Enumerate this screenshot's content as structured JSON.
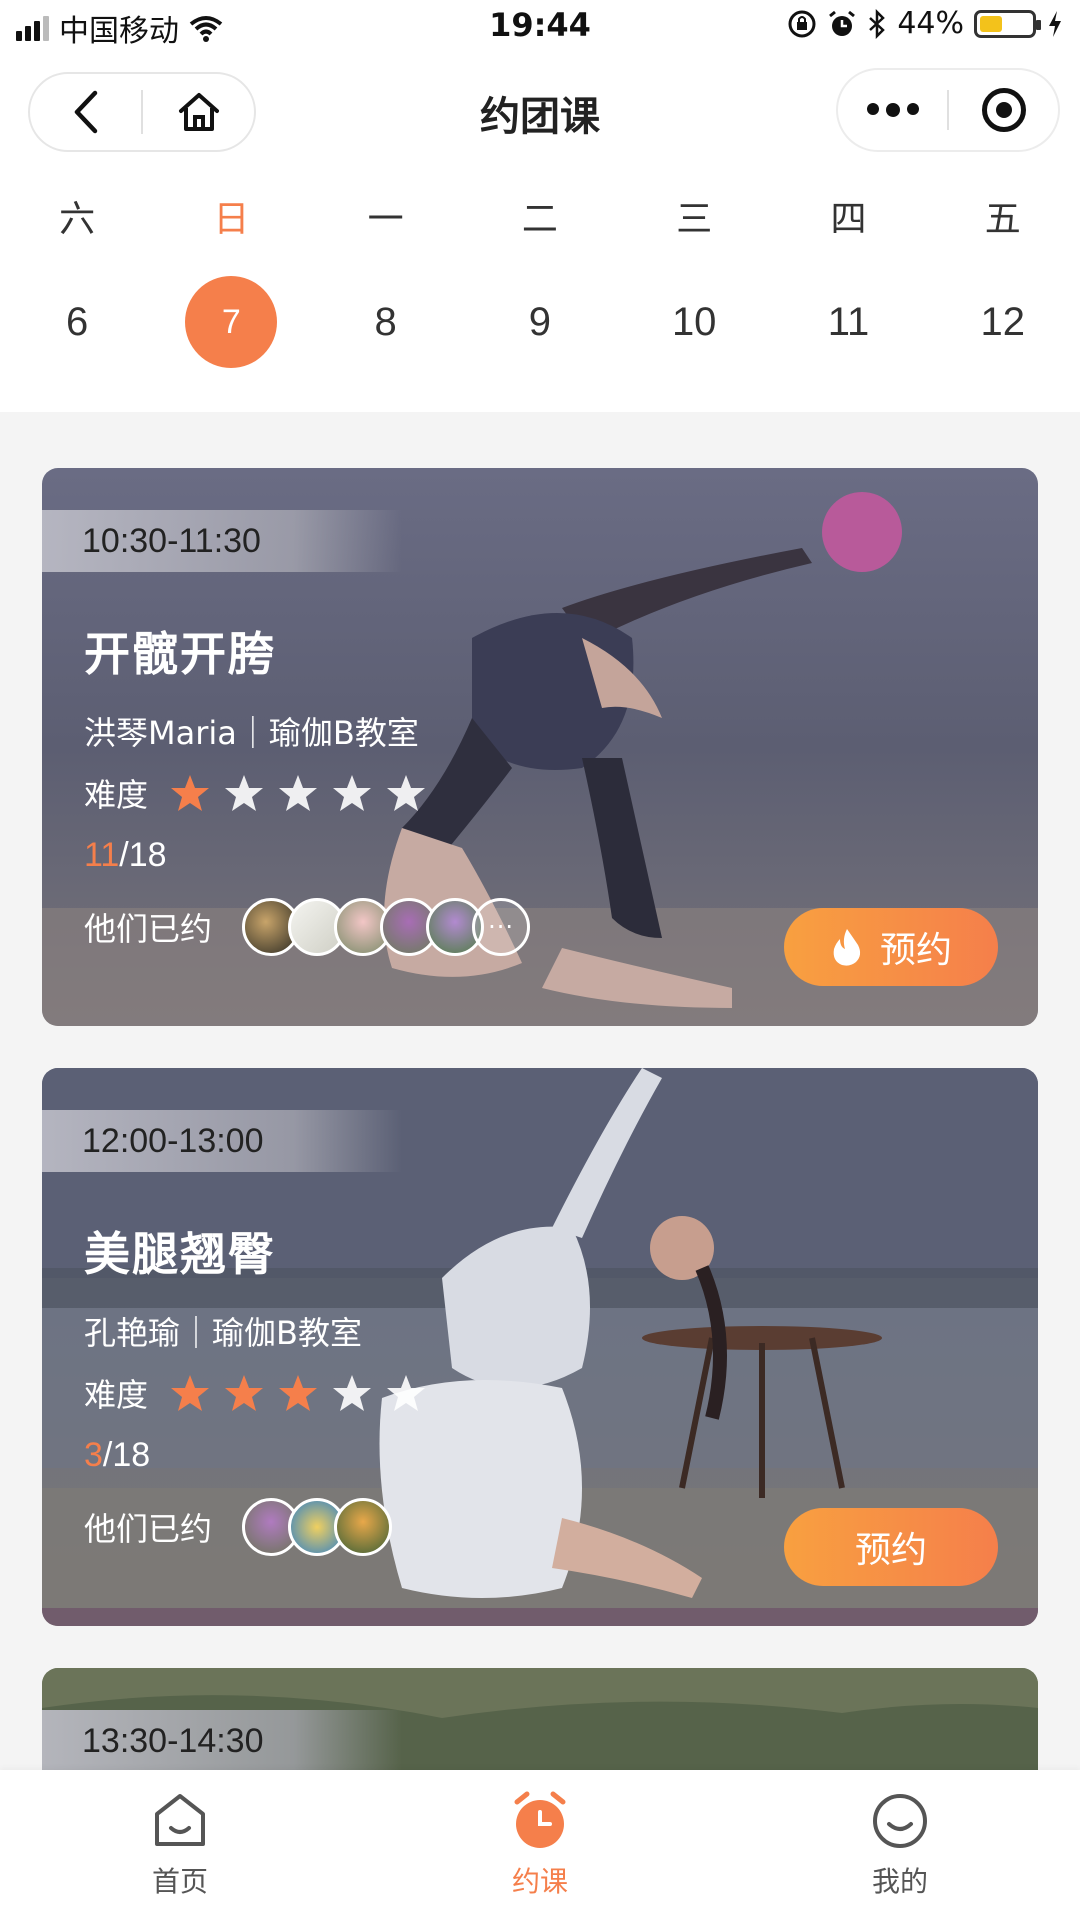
{
  "status_bar": {
    "carrier": "中国移动",
    "time": "19:44",
    "battery_percent": "44%",
    "battery_level": 0.44,
    "icons": [
      "signal-icon",
      "wifi-icon",
      "lock-rotation-icon",
      "alarm-icon",
      "bluetooth-icon",
      "battery-icon",
      "charging-icon"
    ]
  },
  "nav": {
    "title": "约团课",
    "back_icon": "chevron-left-icon",
    "home_icon": "home-icon",
    "more_icon": "more-dots-icon",
    "close_icon": "target-icon"
  },
  "calendar": {
    "weekdays": [
      "六",
      "日",
      "一",
      "二",
      "三",
      "四",
      "五"
    ],
    "dates": [
      "6",
      "7",
      "8",
      "9",
      "10",
      "11",
      "12"
    ],
    "selected_index": 1,
    "accent": "#f57f4b"
  },
  "classes": [
    {
      "time": "10:30-11:30",
      "title": "开髋开胯",
      "meta": "洪琴Maria｜瑜伽B教室",
      "difficulty_label": "难度",
      "difficulty": 1,
      "difficulty_max": 5,
      "booked": "11",
      "capacity": "/18",
      "joined_label": "他们已约",
      "book_label": "预约",
      "book_icon": "flame-icon"
    },
    {
      "time": "12:00-13:00",
      "title": "美腿翘臀",
      "meta": "孔艳瑜｜瑜伽B教室",
      "difficulty_label": "难度",
      "difficulty": 3,
      "difficulty_max": 5,
      "booked": "3",
      "capacity": "/18",
      "joined_label": "他们已约",
      "book_label": "预约"
    },
    {
      "time": "13:30-14:30"
    }
  ],
  "tabbar": {
    "items": [
      {
        "label": "首页",
        "icon": "home-smile-icon"
      },
      {
        "label": "约课",
        "icon": "alarm-clock-icon"
      },
      {
        "label": "我的",
        "icon": "profile-smile-icon"
      }
    ],
    "active_index": 1
  }
}
